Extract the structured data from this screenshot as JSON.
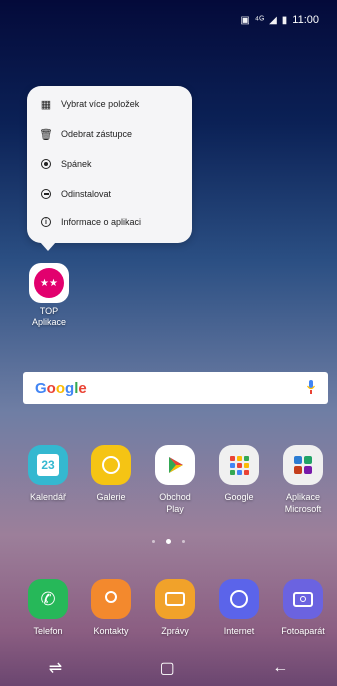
{
  "status_bar": {
    "time": "11:00"
  },
  "popup_menu": [
    {
      "label": "Vybrat více položek",
      "icon": "select-multiple-icon"
    },
    {
      "label": "Odebrat zástupce",
      "icon": "trash-icon"
    },
    {
      "label": "Spánek",
      "icon": "sleep-icon"
    },
    {
      "label": "Odinstalovat",
      "icon": "uninstall-icon"
    },
    {
      "label": "Informace o aplikaci",
      "icon": "info-icon"
    }
  ],
  "top_app": {
    "label_line1": "TOP",
    "label_line2": "Aplikace"
  },
  "search": {
    "logo": "Google"
  },
  "apps": [
    {
      "label": "Kalendář",
      "line2": "",
      "icon": "calendar-icon",
      "value": "23",
      "color": "#34b8d0"
    },
    {
      "label": "Galerie",
      "line2": "",
      "icon": "gallery-icon",
      "color": "#f5c414"
    },
    {
      "label": "Obchod",
      "line2": "Play",
      "icon": "play-store-icon",
      "color": "#ffffff"
    },
    {
      "label": "Google",
      "line2": "",
      "icon": "google-folder-icon",
      "color": "#f0f0f0"
    },
    {
      "label": "Aplikace",
      "line2": "Microsoft",
      "icon": "microsoft-folder-icon",
      "color": "#f0f0f0"
    }
  ],
  "dock": [
    {
      "label": "Telefon",
      "icon": "phone-icon",
      "color": "#26b859"
    },
    {
      "label": "Kontakty",
      "icon": "contacts-icon",
      "color": "#f3892d"
    },
    {
      "label": "Zprávy",
      "icon": "messages-icon",
      "color": "#f1a22a"
    },
    {
      "label": "Internet",
      "icon": "internet-icon",
      "color": "#5b64ea"
    },
    {
      "label": "Fotoaparát",
      "icon": "camera-icon",
      "color": "#6b63e0"
    }
  ],
  "page_indicator": {
    "count": 3,
    "active": 1
  }
}
